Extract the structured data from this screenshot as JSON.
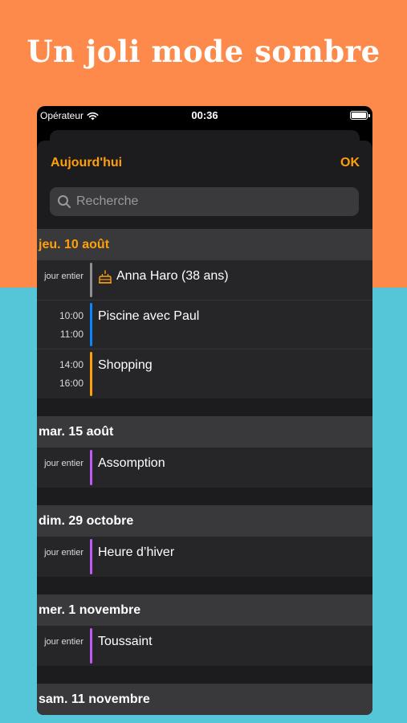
{
  "headline": "Un joli mode sombre",
  "status_bar": {
    "carrier": "Opérateur",
    "time": "00:36"
  },
  "nav": {
    "today_label": "Aujourd'hui",
    "ok_label": "OK"
  },
  "search": {
    "placeholder": "Recherche"
  },
  "colors": {
    "accent": "#ff9f0a",
    "top_bg": "#fd8a4a",
    "bottom_bg": "#55c6d8",
    "holiday": "#bf5af2",
    "birthday": "#8e8e93",
    "work": "#0a84ff",
    "personal": "#ff9f0a"
  },
  "sections": [
    {
      "date": "jeu. 10 août",
      "events": [
        {
          "allday": "jour entier",
          "title": "Anna Haro (38 ans)",
          "icon": "birthday-cake-icon"
        },
        {
          "start": "10:00",
          "end": "11:00",
          "title": "Piscine avec Paul"
        },
        {
          "start": "14:00",
          "end": "16:00",
          "title": "Shopping"
        }
      ]
    },
    {
      "date": "mar. 15 août",
      "events": [
        {
          "allday": "jour entier",
          "title": "Assomption"
        }
      ]
    },
    {
      "date": "dim. 29 octobre",
      "events": [
        {
          "allday": "jour entier",
          "title": "Heure d’hiver"
        }
      ]
    },
    {
      "date": "mer. 1 novembre",
      "events": [
        {
          "allday": "jour entier",
          "title": "Toussaint"
        }
      ]
    },
    {
      "date": "sam. 11 novembre",
      "events": []
    }
  ]
}
